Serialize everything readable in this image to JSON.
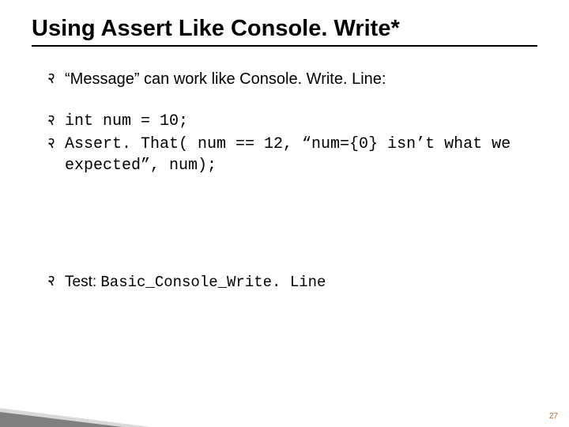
{
  "slide": {
    "title": "Using Assert Like Console. Write*",
    "bullets": {
      "intro": "“Message” can work like Console. Write. Line:",
      "code1": "int num = 10;",
      "code2": "Assert. That( num == 12, “num={0} isn’t what we expected”, num);",
      "test_label": "Test: ",
      "test_code": "Basic_Console_Write. Line"
    },
    "bullet_marker": "२",
    "page_number": "27"
  }
}
